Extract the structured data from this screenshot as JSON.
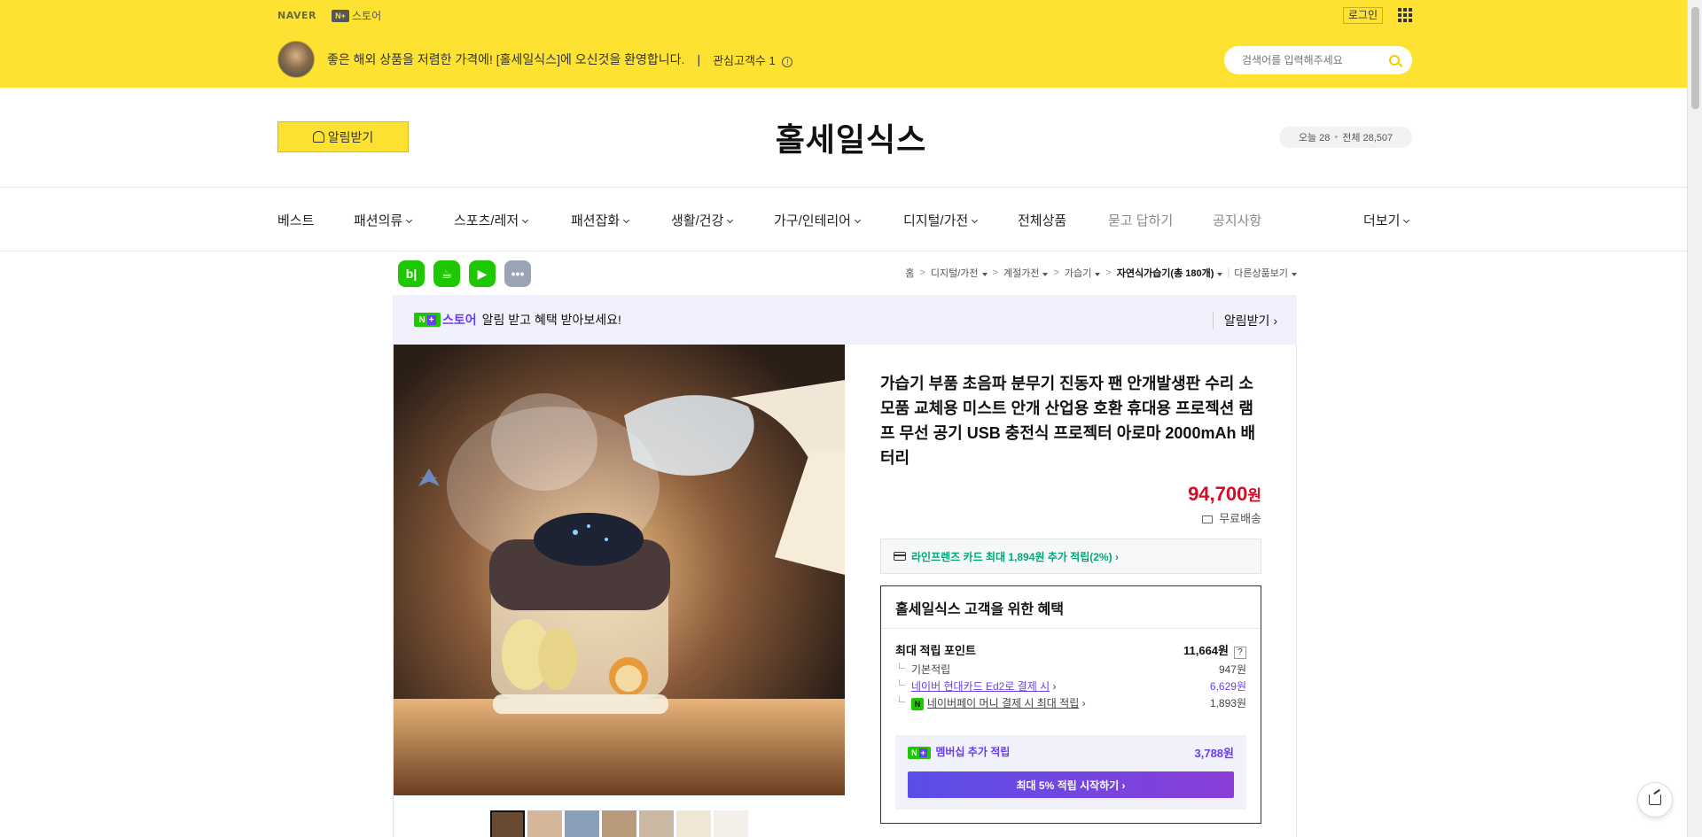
{
  "topbar": {
    "naver_logo": "NAVER",
    "nplus_mark": "N+",
    "nplus_store": "스토어",
    "login": "로그인"
  },
  "welcome": {
    "message": "좋은 해외 상품을 저렴한 가격에! [홀세일식스]에 오신것을 환영합니다.",
    "separator": "|",
    "interest_label": "관심고객수",
    "interest_count": "1",
    "search_placeholder": "검색어를 입력해주세요"
  },
  "header": {
    "alarm_button": "알림받기",
    "store_title": "홀세일식스",
    "visits_today": "오늘 28",
    "visits_total": "전체 28,507"
  },
  "nav": {
    "items": [
      {
        "label": "베스트"
      },
      {
        "label": "패션의류"
      },
      {
        "label": "스포츠/레저"
      },
      {
        "label": "패션잡화"
      },
      {
        "label": "생활/건강"
      },
      {
        "label": "가구/인테리어"
      },
      {
        "label": "디지털/가전"
      },
      {
        "label": "전체상품"
      },
      {
        "label": "묻고 답하기"
      },
      {
        "label": "공지사항"
      },
      {
        "label": "더보기"
      }
    ]
  },
  "share": {
    "blog": "b|",
    "cafe": "☕",
    "bookmark": "▶",
    "more": "•••"
  },
  "breadcrumb": {
    "home": "홈",
    "cat1": "디지털/가전",
    "cat2": "계절가전",
    "cat3": "가습기",
    "cat4": "자연식가습기(총 180개)",
    "other": "다른상품보기",
    "sep": ">"
  },
  "notice": {
    "store_label": "스토어",
    "text": "알림 받고 혜택 받아보세요!",
    "link": "알림받기 ›"
  },
  "product": {
    "title": "가습기 부품 초음파 분무기 진동자 팬 안개발생판 수리 소모품 교체용 미스트 안개 산업용 호환 휴대용 프로젝션 램프 무선 공기 USB 충전식 프로젝터 아로마 2000mAh 배터리",
    "price": "94,700",
    "price_unit": "원",
    "delivery": "무료배송",
    "card_promo": "라인프렌즈 카드 최대 1,894원 추가 적립(2%) ›"
  },
  "benefit": {
    "title": "홀세일식스 고객을 위한 혜택",
    "max_label": "최대 적립 포인트",
    "max_value": "11,664원",
    "help": "?",
    "basic_label": "기본적립",
    "basic_value": "947원",
    "hyundai_label": "네이버 현대카드 Ed2로 결제 시",
    "hyundai_value": "6,629원",
    "npay_label": "네이버페이 머니 결제 시 최대 적립",
    "npay_value": "1,893원",
    "npay_mark": "N",
    "membership_label": "멤버십 추가 적립",
    "membership_value": "3,788원",
    "membership_button": "최대 5% 적립 시작하기 ›"
  },
  "colors": {
    "brand_yellow": "#fde232",
    "price_red": "#d50b27",
    "naver_green": "#1ec800",
    "plus_purple": "#6a3ef0"
  }
}
